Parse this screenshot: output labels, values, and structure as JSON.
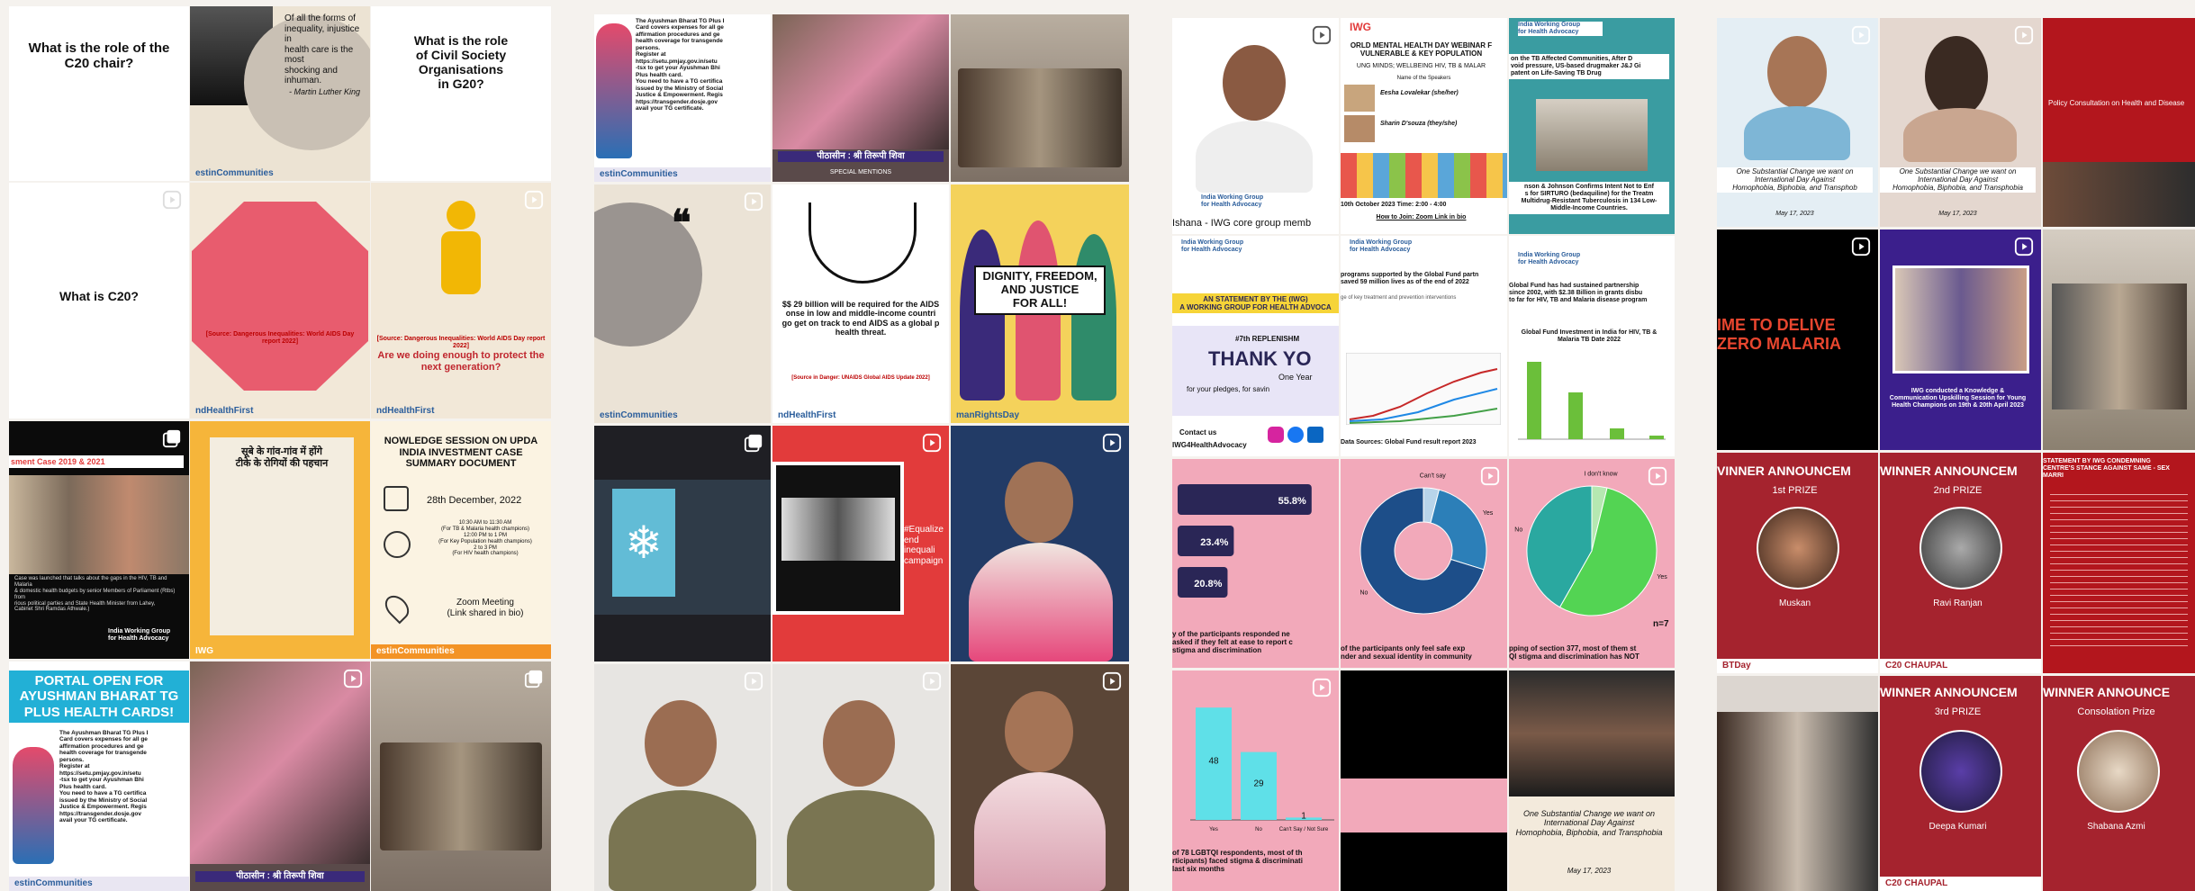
{
  "panel1": {
    "t1": "What is the role of the\nC20 chair?",
    "t2_quote": "Of all the forms of\ninequality, injustice in\nhealth care is the most\nshocking and inhuman.",
    "t2_author": "- Martin Luther King",
    "t2_footer": "estinCommunities",
    "t3": "What is the role\nof Civil Society Organisations\nin G20?",
    "t4": "What is C20?",
    "t5_src": "[Source: Dangerous Inequalities: World AIDS Day\nreport 2022]",
    "t5_footer": "ndHealthFirst",
    "t6_src": "[Source: Dangerous Inequalities: World AIDS Day report 2022]",
    "t6_q": "Are we doing enough to protect the\nnext generation?",
    "t6_footer": "ndHealthFirst",
    "t7_head": "sment Case 2019 & 2021",
    "t7_body": "Case was launched that talks about the gaps in the HIV, TB and Malaria\n& domestic health budgets by senior Members of Parliament (Rtbs) from\nrious political parties and State Health Minister from Lahey,\nCabinet Shri Ramdas Athwale.)",
    "t7_org": "India Working Group\nfor Health Advocacy",
    "t8_hindi": "सूबे के गांव-गांव में होंगे\nटीके के रोगियों की पहचान",
    "t9_head": "NOWLEDGE SESSION ON UPDA\nINDIA INVESTMENT CASE\nSUMMARY DOCUMENT",
    "t9_date": "28th December, 2022",
    "t9_times": "10:30 AM to 11:30 AM\n(For TB & Malaria health champions)\n12:00 PM to 1 PM\n(For Key Population health champions)\n2 to 3 PM\n(For HIV health champions)",
    "t9_zoom": "Zoom Meeting\n(Link shared in bio)",
    "t9_footer": "estinCommunities",
    "t10_head": "PORTAL OPEN FOR\nAYUSHMAN BHARAT TG\nPLUS HEALTH CARDS!",
    "t10_body": "The Ayushman Bharat TG Plus I\nCard covers expenses for all ge\naffirmation procedures and ge\nhealth coverage for transgende\npersons.\nRegister at\nhttps://setu.pmjay.gov.in/setu\n-tsx to get your Ayushman Bhi\nPlus health card.\nYou need to have a TG certifica\nissued by the Ministry of Social\nJustice & Empowerment. Regis\nhttps://transgender.dosje.gov\navail your TG certificate.",
    "t10_footer": "estinCommunities",
    "t11_caption": "पीठासीन : श्री तिरूपी शिवा",
    "logo": "IWG"
  },
  "panel2": {
    "t1_body": "The Ayushman Bharat TG Plus I\nCard covers expenses for all ge\naffirmation procedures and ge\nhealth coverage for transgende\npersons.\nRegister at\nhttps://setu.pmjay.gov.in/setu\n-tsx to get your Ayushman Bhi\nPlus health card.\nYou need to have a TG certifica\nissued by the Ministry of Social\nJustice & Empowerment. Regis\nhttps://transgender.dosje.gov\navail your TG certificate.",
    "t1_footer": "estinCommunities",
    "t2_caption": "पीठासीन : श्री तिरूपी शिवा",
    "t2_sub": "SPECIAL MENTIONS",
    "t4_footer": "estinCommunities",
    "t5_text": "$$ 29 billion will be required for the AIDS\nonse in low and middle-income countri\ngo get on track to end AIDS as a global p\nhealth threat.",
    "t5_src": "[Source in Danger: UNAIDS Global AIDS Update 2022]",
    "t5_footer": "ndHealthFirst",
    "t6_banner": "DIGNITY, FREEDOM,\nAND JUSTICE\nFOR ALL!",
    "t6_footer": "manRightsDay",
    "t8_text": "#Equalize\nend inequali\ncampaign"
  },
  "panel3": {
    "t1_caption": "Ishana - IWG core group memb",
    "t1_org": "India Working Group\nfor Health Advocacy",
    "t2_head": "ORLD MENTAL HEALTH DAY WEBINAR F\nVULNERABLE & KEY POPULATION",
    "t2_sub": "UNG MINDS; WELLBEING HIV, TB & MALAR",
    "t2_speakers": "Name of the Speakers",
    "t2_s1": "Eesha Lovalekar (she/her)",
    "t2_s2": "Sharin D'souza (they/she)",
    "t2_date": "10th October 2023   Time: 2:00 - 4:00",
    "t2_join": "How to Join: Zoom Link in bio",
    "t3_head": "on the TB Affected Communities, After D\nvoid pressure, US-based drugmaker J&J Gi\npatent on Life-Saving TB Drug",
    "t3_foot": "nson & Johnson Confirms Intent Not to Enf\ns for SIRTURO (bedaquiline) for the Treatm\nMultidrug-Resistant Tuberculosis in 134 Low-\nMiddle-Income Countries.",
    "t4_head": "AN STATEMENT BY THE (IWG)\nA WORKING GROUP FOR HEALTH ADVOCA",
    "t4_sub": "#7th REPLENISHM",
    "t4_thank": "THANK YO",
    "t4_one": "One Year",
    "t4_pledge": "for your pledges, for savin",
    "t4_contact": "Contact us",
    "t4_handle": "IWG4HealthAdvocacy",
    "t5_head": "programs supported by the Global Fund partn\nsaved 59 million lives as of the end of 2022",
    "t5_sub": "ge of key treatment and prevention interventions",
    "t5_src": "Data Sources: Global Fund result report 2023",
    "t6_text": "Global Fund has had sustained partnership\nsince 2002, with $2.38 Billion in grants disbu\nto far for HIV, TB and Malaria disease program",
    "t6_chart": "Global Fund Investment in India for HIV, TB &\nMalaria TB Date 2022",
    "t7_caption": "y of the participants responded ne\nasked if they felt at ease to report c\nstigma and discrimination",
    "t8_caption": "of the participants only feel safe exp\nnder and sexual identity in community",
    "t9_caption": "pping of section 377, most of them st\nQI stigma and discrimination has NOT",
    "t9_n": "n=7",
    "t10_caption": "of 78 LGBTQI respondents, most of th\nrticipants) faced stigma & discriminati\nlast six months",
    "t12_caption": "One Substantial Change we want on\nInternational Day Against\nHomophobia, Biphobia, and Transphobia",
    "t12_date": "May 17, 2023"
  },
  "panel4": {
    "t1_caption": "One Substantial Change we want on\nInternational Day Against\nHomophobia, Biphobia, and Transphob",
    "t1_date": "May 17, 2023",
    "t2_caption": "One Substantial Change we want on\nInternational Day Against\nHomophobia, Biphobia, and Transphobia",
    "t2_date": "May 17, 2023",
    "t3_head": "Policy Consultation on Health and Disease",
    "t4_text": "IME TO DELIVE\nZERO MALARIA",
    "t5_text": "IWG conducted a Knowledge &\nCommunication Upskilling Session for Young\nHealth Champions on 19th & 20th April 2023",
    "t7_head": "VINNER ANNOUNCEM",
    "t7_prize": "1st PRIZE",
    "t7_name": "Muskan",
    "t7_footer": "BTDay",
    "t8_head": "WINNER ANNOUNCEM",
    "t8_prize": "2nd PRIZE",
    "t8_name": "Ravi Ranjan",
    "t8_footer": "C20 CHAUPAL",
    "t9_head": "STATEMENT BY IWG CONDEMNING\nCENTRE'S STANCE AGAINST SAME - SEX MARRI",
    "t10_footer": "C20 CHAUPAL",
    "t11_head": "WINNER ANNOUNCEM",
    "t11_prize": "3rd PRIZE",
    "t11_name": "Deepa Kumari",
    "t12_head": "WINNER ANNOUNCE",
    "t12_prize": "Consolation Prize",
    "t12_name": "Shabana Azmi"
  },
  "chart_data": [
    {
      "type": "bar",
      "categories": [
        "",
        "",
        ""
      ],
      "values": [
        55.8,
        23.4,
        20.8
      ],
      "title": "",
      "xlabel": "",
      "ylabel": "",
      "xlim": [
        0,
        60
      ]
    },
    {
      "type": "pie",
      "categories": [
        "Can't say",
        "Yes",
        "No",
        "Can't Say"
      ],
      "values": [
        4,
        25.8,
        70.2,
        0
      ],
      "title": ""
    },
    {
      "type": "pie",
      "categories": [
        "I don't know",
        "Yes",
        "No"
      ],
      "values": [
        3.8,
        54.4,
        41.8
      ],
      "title": ""
    },
    {
      "type": "bar",
      "categories": [
        "Yes",
        "No",
        "Can't Say / Not Sure"
      ],
      "values": [
        48,
        29,
        1
      ],
      "ylim": [
        0,
        50
      ],
      "title": ""
    }
  ],
  "colors": {
    "panel_bg": "#f5f2ee",
    "pink": "#f0a7b8",
    "red_bg": "#a5232e",
    "navy": "#2a2656",
    "orange": "#f39325",
    "yellow": "#f4d25b"
  }
}
